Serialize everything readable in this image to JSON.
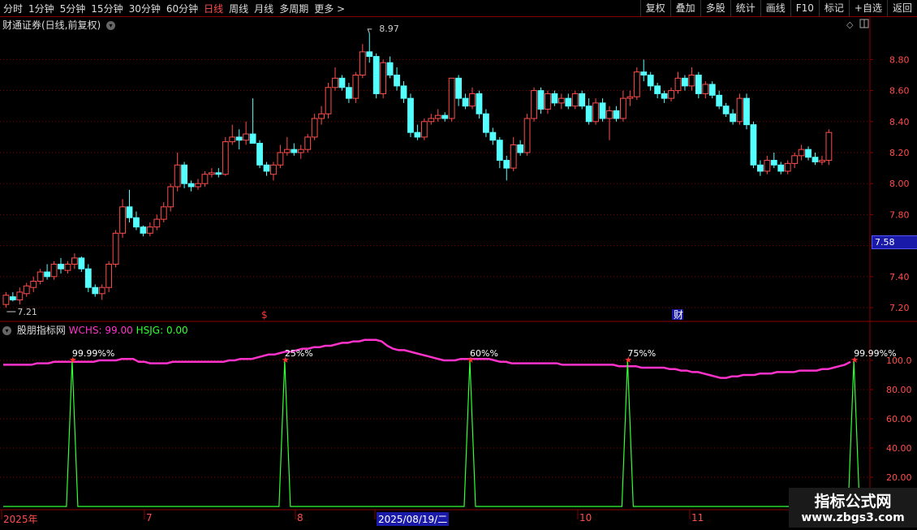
{
  "toolbar": {
    "periods": [
      "分时",
      "1分钟",
      "5分钟",
      "15分钟",
      "30分钟",
      "60分钟",
      "日线",
      "周线",
      "月线",
      "多周期",
      "更多 >"
    ],
    "active_period": "日线",
    "right_buttons": [
      "复权",
      "叠加",
      "多股",
      "统计",
      "画线",
      "F10",
      "标记",
      "+自选",
      "返回"
    ]
  },
  "main_chart": {
    "title": "财通证券(日线,前复权)",
    "y_ticks": [
      "8.80",
      "8.60",
      "8.40",
      "8.20",
      "8.00",
      "7.80",
      "7.60",
      "7.40",
      "7.20"
    ],
    "current_price": "7.58",
    "high_label": "8.97",
    "low_label": "7.21",
    "event_markers": [
      "$",
      "财"
    ]
  },
  "indicator": {
    "name": "股朋指标网",
    "wchs_label": "WCHS: 99.00",
    "hsjg_label": "HSJG: 0.00",
    "y_ticks": [
      "100.0",
      "80.00",
      "60.00",
      "40.00",
      "20.00"
    ],
    "peak_labels": [
      "99.99%%",
      "25%%",
      "60%%",
      "75%%",
      "99.99%%"
    ]
  },
  "x_axis": {
    "labels": [
      "2025年",
      "7",
      "8",
      "2025/08/19/二",
      "10",
      "11"
    ],
    "selected": "2025/08/19/二"
  },
  "watermark": {
    "line1": "指标公式网",
    "line2": "www.zbgs3.com"
  },
  "colors": {
    "up": "#ff4d4d",
    "down": "#54ffff",
    "wchs": "#ff33cc",
    "hsjg": "#33ff33",
    "grid": "#8b0000"
  },
  "chart_data": {
    "type": "candlestick",
    "ohlc": [
      [
        7.22,
        7.3,
        7.2,
        7.28
      ],
      [
        7.27,
        7.3,
        7.24,
        7.25
      ],
      [
        7.25,
        7.33,
        7.22,
        7.3
      ],
      [
        7.29,
        7.36,
        7.27,
        7.34
      ],
      [
        7.33,
        7.4,
        7.3,
        7.37
      ],
      [
        7.37,
        7.45,
        7.35,
        7.43
      ],
      [
        7.43,
        7.48,
        7.38,
        7.4
      ],
      [
        7.4,
        7.5,
        7.38,
        7.48
      ],
      [
        7.48,
        7.52,
        7.42,
        7.45
      ],
      [
        7.44,
        7.5,
        7.42,
        7.48
      ],
      [
        7.48,
        7.55,
        7.45,
        7.52
      ],
      [
        7.52,
        7.53,
        7.43,
        7.45
      ],
      [
        7.45,
        7.48,
        7.3,
        7.33
      ],
      [
        7.33,
        7.35,
        7.27,
        7.29
      ],
      [
        7.29,
        7.35,
        7.25,
        7.33
      ],
      [
        7.33,
        7.5,
        7.3,
        7.48
      ],
      [
        7.48,
        7.7,
        7.46,
        7.68
      ],
      [
        7.68,
        7.9,
        7.65,
        7.85
      ],
      [
        7.85,
        7.96,
        7.75,
        7.78
      ],
      [
        7.78,
        7.82,
        7.7,
        7.72
      ],
      [
        7.72,
        7.73,
        7.66,
        7.68
      ],
      [
        7.68,
        7.75,
        7.66,
        7.72
      ],
      [
        7.72,
        7.8,
        7.7,
        7.77
      ],
      [
        7.77,
        7.88,
        7.75,
        7.85
      ],
      [
        7.85,
        8.0,
        7.82,
        7.98
      ],
      [
        7.98,
        8.2,
        7.95,
        8.12
      ],
      [
        8.12,
        8.14,
        7.97,
        8.0
      ],
      [
        8.0,
        8.02,
        7.95,
        7.98
      ],
      [
        7.98,
        8.03,
        7.96,
        8.0
      ],
      [
        8.0,
        8.08,
        7.98,
        8.06
      ],
      [
        8.06,
        8.1,
        8.04,
        8.07
      ],
      [
        8.07,
        8.1,
        8.04,
        8.06
      ],
      [
        8.06,
        8.3,
        8.05,
        8.27
      ],
      [
        8.27,
        8.38,
        8.25,
        8.3
      ],
      [
        8.3,
        8.35,
        8.22,
        8.28
      ],
      [
        8.28,
        8.4,
        8.25,
        8.32
      ],
      [
        8.32,
        8.55,
        8.28,
        8.26
      ],
      [
        8.26,
        8.28,
        8.1,
        8.12
      ],
      [
        8.12,
        8.14,
        8.05,
        8.08
      ],
      [
        8.06,
        8.14,
        8.02,
        8.12
      ],
      [
        8.12,
        8.25,
        8.1,
        8.2
      ],
      [
        8.2,
        8.3,
        8.18,
        8.22
      ],
      [
        8.22,
        8.26,
        8.18,
        8.2
      ],
      [
        8.2,
        8.25,
        8.16,
        8.22
      ],
      [
        8.22,
        8.32,
        8.2,
        8.3
      ],
      [
        8.3,
        8.45,
        8.28,
        8.42
      ],
      [
        8.42,
        8.5,
        8.38,
        8.45
      ],
      [
        8.45,
        8.65,
        8.42,
        8.62
      ],
      [
        8.62,
        8.75,
        8.6,
        8.68
      ],
      [
        8.68,
        8.7,
        8.6,
        8.62
      ],
      [
        8.62,
        8.65,
        8.52,
        8.55
      ],
      [
        8.55,
        8.72,
        8.52,
        8.7
      ],
      [
        8.7,
        8.9,
        8.68,
        8.85
      ],
      [
        8.85,
        8.97,
        8.78,
        8.82
      ],
      [
        8.82,
        8.84,
        8.55,
        8.58
      ],
      [
        8.58,
        8.8,
        8.55,
        8.78
      ],
      [
        8.78,
        8.82,
        8.68,
        8.7
      ],
      [
        8.7,
        8.75,
        8.6,
        8.63
      ],
      [
        8.63,
        8.66,
        8.52,
        8.55
      ],
      [
        8.55,
        8.58,
        8.3,
        8.33
      ],
      [
        8.33,
        8.38,
        8.28,
        8.3
      ],
      [
        8.3,
        8.42,
        8.28,
        8.4
      ],
      [
        8.4,
        8.45,
        8.38,
        8.42
      ],
      [
        8.42,
        8.48,
        8.4,
        8.44
      ],
      [
        8.44,
        8.46,
        8.4,
        8.42
      ],
      [
        8.42,
        8.66,
        8.4,
        8.68
      ],
      [
        8.68,
        8.7,
        8.5,
        8.55
      ],
      [
        8.55,
        8.58,
        8.48,
        8.5
      ],
      [
        8.5,
        8.62,
        8.48,
        8.58
      ],
      [
        8.58,
        8.6,
        8.42,
        8.45
      ],
      [
        8.45,
        8.48,
        8.3,
        8.33
      ],
      [
        8.33,
        8.36,
        8.25,
        8.28
      ],
      [
        8.28,
        8.3,
        8.1,
        8.15
      ],
      [
        8.15,
        8.18,
        8.02,
        8.1
      ],
      [
        8.1,
        8.3,
        8.08,
        8.25
      ],
      [
        8.25,
        8.28,
        8.18,
        8.2
      ],
      [
        8.2,
        8.45,
        8.18,
        8.42
      ],
      [
        8.42,
        8.62,
        8.4,
        8.6
      ],
      [
        8.6,
        8.62,
        8.45,
        8.48
      ],
      [
        8.48,
        8.6,
        8.45,
        8.58
      ],
      [
        8.58,
        8.6,
        8.5,
        8.52
      ],
      [
        8.52,
        8.58,
        8.48,
        8.55
      ],
      [
        8.55,
        8.58,
        8.48,
        8.5
      ],
      [
        8.5,
        8.6,
        8.48,
        8.58
      ],
      [
        8.58,
        8.6,
        8.48,
        8.5
      ],
      [
        8.5,
        8.55,
        8.38,
        8.4
      ],
      [
        8.4,
        8.55,
        8.38,
        8.52
      ],
      [
        8.52,
        8.55,
        8.4,
        8.42
      ],
      [
        8.42,
        8.5,
        8.28,
        8.47
      ],
      [
        8.47,
        8.5,
        8.4,
        8.42
      ],
      [
        8.42,
        8.6,
        8.4,
        8.55
      ],
      [
        8.55,
        8.6,
        8.5,
        8.56
      ],
      [
        8.56,
        8.75,
        8.54,
        8.72
      ],
      [
        8.72,
        8.8,
        8.66,
        8.7
      ],
      [
        8.7,
        8.72,
        8.6,
        8.63
      ],
      [
        8.63,
        8.65,
        8.55,
        8.58
      ],
      [
        8.58,
        8.6,
        8.52,
        8.55
      ],
      [
        8.55,
        8.62,
        8.53,
        8.6
      ],
      [
        8.6,
        8.72,
        8.58,
        8.68
      ],
      [
        8.68,
        8.7,
        8.6,
        8.63
      ],
      [
        8.63,
        8.75,
        8.6,
        8.7
      ],
      [
        8.7,
        8.72,
        8.55,
        8.58
      ],
      [
        8.58,
        8.66,
        8.55,
        8.64
      ],
      [
        8.64,
        8.66,
        8.55,
        8.57
      ],
      [
        8.57,
        8.6,
        8.48,
        8.5
      ],
      [
        8.5,
        8.52,
        8.43,
        8.45
      ],
      [
        8.45,
        8.48,
        8.38,
        8.4
      ],
      [
        8.4,
        8.58,
        8.38,
        8.55
      ],
      [
        8.55,
        8.58,
        8.35,
        8.38
      ],
      [
        8.38,
        8.4,
        8.1,
        8.12
      ],
      [
        8.12,
        8.15,
        8.05,
        8.08
      ],
      [
        8.08,
        8.18,
        8.06,
        8.15
      ],
      [
        8.15,
        8.2,
        8.1,
        8.12
      ],
      [
        8.12,
        8.14,
        8.06,
        8.08
      ],
      [
        8.08,
        8.15,
        8.06,
        8.13
      ],
      [
        8.13,
        8.2,
        8.1,
        8.18
      ],
      [
        8.18,
        8.25,
        8.15,
        8.22
      ],
      [
        8.22,
        8.24,
        8.15,
        8.17
      ],
      [
        8.17,
        8.2,
        8.12,
        8.14
      ],
      [
        8.14,
        8.18,
        8.12,
        8.15
      ],
      [
        8.15,
        8.35,
        8.12,
        8.33
      ]
    ],
    "indicator_hsjg_peaks": [
      10,
      41,
      68,
      91,
      124
    ],
    "wchs": [
      97,
      97,
      97,
      97,
      97,
      97,
      98,
      98,
      98,
      99,
      99,
      99,
      99,
      99,
      99,
      99,
      99,
      100,
      100,
      100,
      100,
      101,
      101,
      101,
      99,
      99,
      98,
      98,
      98,
      98,
      99,
      99,
      99,
      99,
      99,
      99,
      99,
      99,
      99,
      99,
      100,
      100,
      101,
      101,
      101,
      102,
      103,
      104,
      104,
      105,
      106,
      106,
      107,
      108,
      108,
      109,
      109,
      110,
      110,
      111,
      112,
      112,
      113,
      113,
      114,
      114,
      114,
      113,
      110,
      108,
      107,
      107,
      106,
      105,
      104,
      103,
      102,
      101,
      100,
      100,
      100,
      101,
      101,
      101,
      101,
      101,
      101,
      100,
      99,
      99,
      98,
      98,
      98,
      98,
      98,
      98,
      98,
      98,
      98,
      97,
      97,
      97,
      97,
      97,
      97,
      97,
      97,
      97,
      97,
      96,
      96,
      96,
      96,
      95,
      95,
      95,
      95,
      95,
      94,
      94,
      93,
      93,
      92,
      92,
      91,
      90,
      89,
      88,
      88,
      89,
      89,
      90,
      90,
      90,
      91,
      91,
      91,
      92,
      92,
      92,
      92,
      93,
      93,
      93,
      93,
      94,
      94,
      95,
      96,
      97,
      99
    ]
  }
}
